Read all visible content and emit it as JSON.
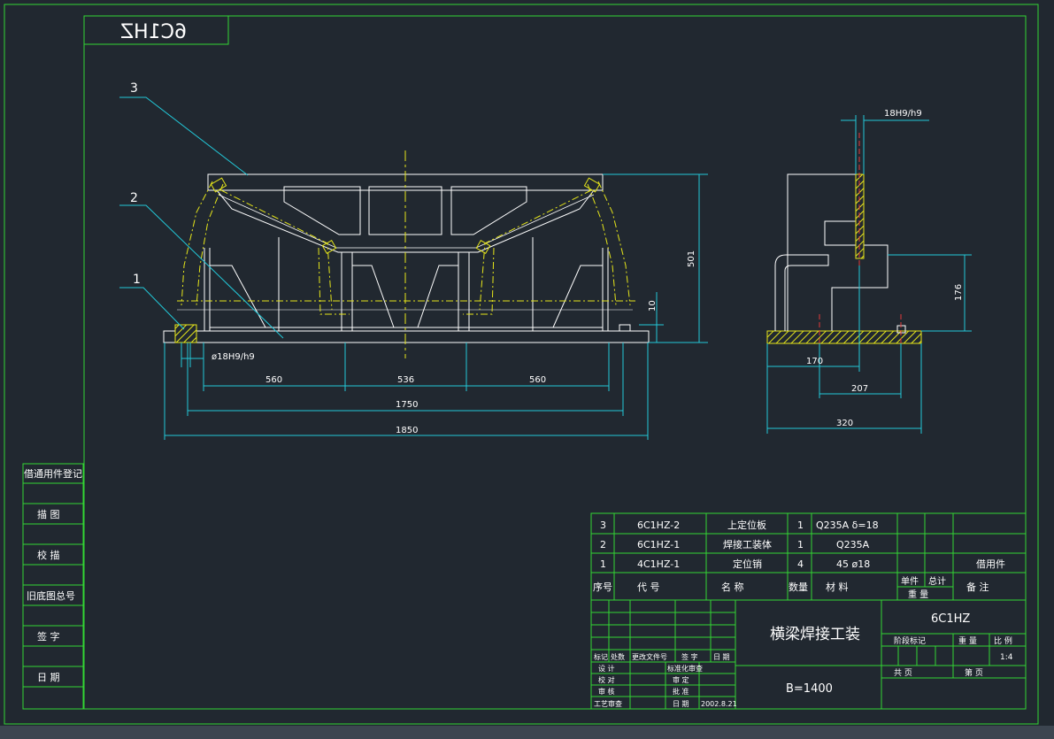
{
  "stamp_mirrored": "6C1HZ",
  "part_labels": [
    "3",
    "2",
    "1"
  ],
  "dims": {
    "fit_top": "18H9/h9",
    "fit_bottom": "ø18H9/h9",
    "h_total": "501",
    "h_small": "10",
    "h_side": "176",
    "w_560a": "560",
    "w_536": "536",
    "w_560b": "560",
    "w_1750": "1750",
    "w_1850": "1850",
    "w_170": "170",
    "w_207": "207",
    "w_320": "320"
  },
  "left_column": [
    "借通用件登记",
    "描  图",
    "校  描",
    "旧底图总号",
    "签  字",
    "日  期"
  ],
  "bom_rows": [
    {
      "no": "3",
      "code": "6C1HZ-2",
      "name": "上定位板",
      "qty": "1",
      "material": "Q235A  δ=18",
      "note": ""
    },
    {
      "no": "2",
      "code": "6C1HZ-1",
      "name": "焊接工装体",
      "qty": "1",
      "material": "Q235A",
      "note": ""
    },
    {
      "no": "1",
      "code": "4C1HZ-1",
      "name": "定位销",
      "qty": "4",
      "material": "45 ø18",
      "note": "借用件"
    }
  ],
  "bom_header": {
    "no": "序号",
    "code": "代     号",
    "name": "名     称",
    "qty": "数量",
    "material": "材     料",
    "unit": "单件",
    "total": "总计",
    "weight": "重     量",
    "note": "备     注"
  },
  "title_block": {
    "title": "横梁焊接工装",
    "spec": "B=1400",
    "drawing_no": "6C1HZ",
    "stage_label": "阶段标记",
    "weight_label": "重  量",
    "scale_label": "比  例",
    "scale": "1:4",
    "total_sheets": "共        页",
    "sheet_no": "第        页",
    "rev_mark": "标记",
    "rev_qty": "处数",
    "rev_doc": "更改文件号",
    "rev_sign": "签  字",
    "rev_date": "日  期",
    "design": "设  计",
    "check": "校  对",
    "review": "审  核",
    "process": "工艺审查",
    "standard": "标准化审查",
    "audit": "审  定",
    "approve": "批  准",
    "date_label": "日  期",
    "date": "2002.8.21"
  },
  "colors": {
    "background": "#212830",
    "frame": "#33d633",
    "outline": "#ffffff",
    "centerline": "#e6e61a",
    "dimension": "#22c8d8",
    "hidden": "#e23a3a",
    "text": "#ffffff"
  }
}
